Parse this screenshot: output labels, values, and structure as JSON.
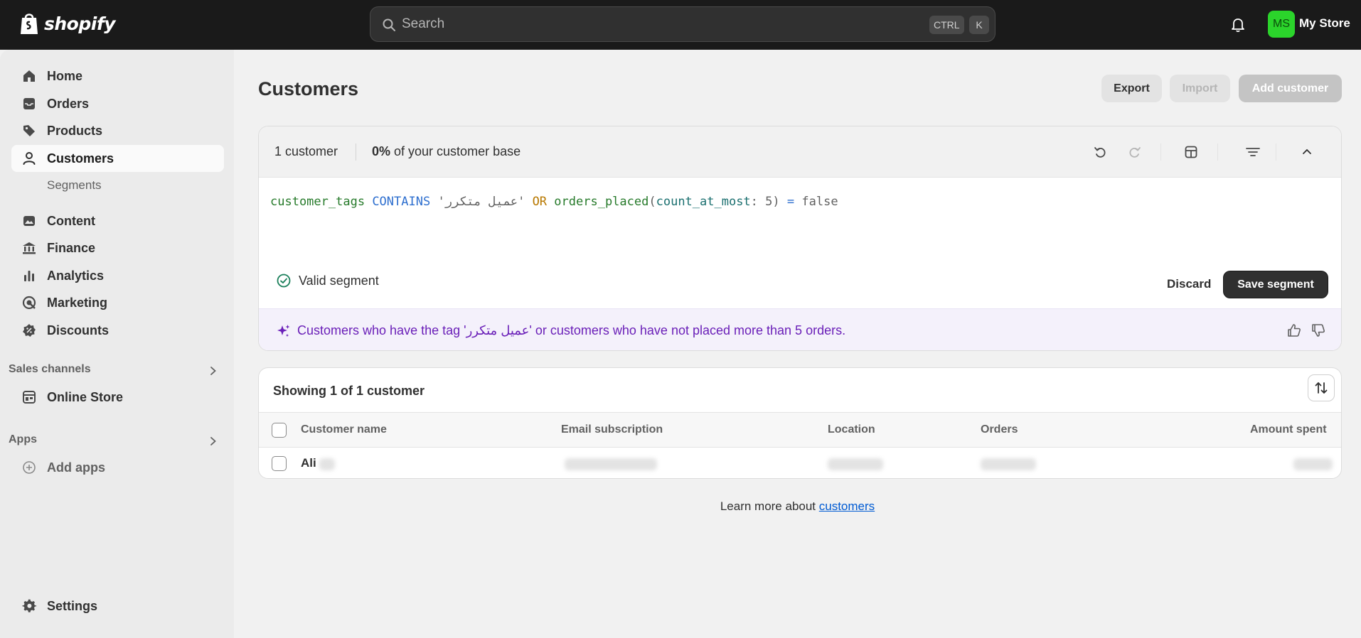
{
  "app": {
    "brand": "shopify",
    "store_name": "My Store",
    "avatar_initials": "MS"
  },
  "search": {
    "placeholder": "Search",
    "shortcut_ctrl": "CTRL",
    "shortcut_key": "K"
  },
  "sidebar": {
    "items": [
      {
        "label": "Home",
        "icon": "home-icon"
      },
      {
        "label": "Orders",
        "icon": "inbox-icon"
      },
      {
        "label": "Products",
        "icon": "tag-icon"
      },
      {
        "label": "Customers",
        "icon": "person-icon",
        "active": true
      },
      {
        "label": "Segments"
      },
      {
        "label": "Content",
        "icon": "image-icon"
      },
      {
        "label": "Finance",
        "icon": "bank-icon"
      },
      {
        "label": "Analytics",
        "icon": "bar-chart-icon"
      },
      {
        "label": "Marketing",
        "icon": "target-icon"
      },
      {
        "label": "Discounts",
        "icon": "discount-icon"
      }
    ],
    "sales_channels": {
      "label": "Sales channels",
      "items": [
        {
          "label": "Online Store",
          "icon": "store-icon"
        }
      ]
    },
    "apps": {
      "label": "Apps",
      "items": [
        {
          "label": "Add apps",
          "icon": "plus-circle-icon"
        }
      ]
    },
    "settings": {
      "label": "Settings",
      "icon": "gear-icon"
    }
  },
  "page": {
    "title": "Customers",
    "actions": {
      "export": "Export",
      "import": "Import",
      "add_customer": "Add customer"
    }
  },
  "segment": {
    "count": "1 customer",
    "base_percent": "0%",
    "base_suffix": " of your customer base",
    "query": {
      "field": "customer_tags",
      "op": "CONTAINS",
      "value": "'عميل متكرر'",
      "or": "OR",
      "func": "orders_placed",
      "param": "count_at_most",
      "num": "5",
      "eq": "=",
      "bool": "false"
    },
    "valid_label": "Valid segment",
    "discard": "Discard",
    "save": "Save segment",
    "ai_summary": "Customers who have the tag 'عميل متكرر' or customers who have not placed more than 5 orders."
  },
  "customer_list": {
    "heading": "Showing 1 of 1 customer",
    "columns": [
      "Customer name",
      "Email subscription",
      "Location",
      "Orders",
      "Amount spent"
    ],
    "rows": [
      {
        "name": "Ali"
      }
    ]
  },
  "footer": {
    "learn_prefix": "Learn more about ",
    "learn_link": "customers"
  },
  "colors": {
    "topbar": "#1a1a1a",
    "accent_ai": "#6a1fb8",
    "valid_green": "#1a7f5a",
    "link": "#005bd3",
    "avatar": "#2bd42b"
  }
}
